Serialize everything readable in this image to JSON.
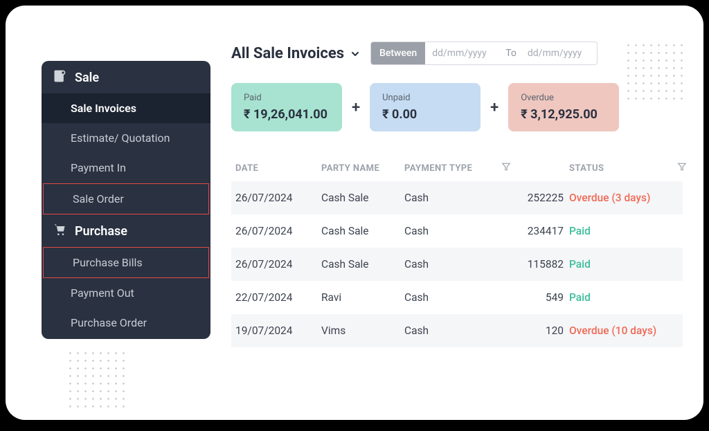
{
  "sidebar": {
    "groups": [
      {
        "id": "sale",
        "label": "Sale",
        "items": [
          {
            "id": "sale-invoices",
            "label": "Sale Invoices",
            "active": true,
            "boxed": false
          },
          {
            "id": "estimate-quotation",
            "label": "Estimate/ Quotation",
            "active": false,
            "boxed": false
          },
          {
            "id": "payment-in",
            "label": "Payment In",
            "active": false,
            "boxed": false
          },
          {
            "id": "sale-order",
            "label": "Sale Order",
            "active": false,
            "boxed": true
          }
        ]
      },
      {
        "id": "purchase",
        "label": "Purchase",
        "items": [
          {
            "id": "purchase-bills",
            "label": "Purchase Bills",
            "active": false,
            "boxed": true
          },
          {
            "id": "payment-out",
            "label": "Payment Out",
            "active": false,
            "boxed": false
          },
          {
            "id": "purchase-order",
            "label": "Purchase Order",
            "active": false,
            "boxed": false
          }
        ]
      }
    ]
  },
  "header": {
    "title": "All Sale Invoices",
    "between_label": "Between",
    "to_label": "To",
    "date_placeholder": "dd/mm/yyyy"
  },
  "summary": {
    "paid": {
      "label": "Paid",
      "value": "₹ 19,26,041.00"
    },
    "unpaid": {
      "label": "Unpaid",
      "value": "₹ 0.00"
    },
    "overdue": {
      "label": "Overdue",
      "value": "₹ 3,12,925.00"
    },
    "plus": "+"
  },
  "table": {
    "columns": {
      "date": "DATE",
      "party": "PARTY NAME",
      "payment_type": "PAYMENT TYPE",
      "amount": "",
      "status": "STATUS"
    },
    "rows": [
      {
        "date": "26/07/2024",
        "party": "Cash Sale",
        "payment_type": "Cash",
        "amount": "252225",
        "status_text": "Overdue (3 days)",
        "status_kind": "overdue"
      },
      {
        "date": "26/07/2024",
        "party": "Cash Sale",
        "payment_type": "Cash",
        "amount": "234417",
        "status_text": "Paid",
        "status_kind": "paid"
      },
      {
        "date": "26/07/2024",
        "party": "Cash Sale",
        "payment_type": "Cash",
        "amount": "115882",
        "status_text": "Paid",
        "status_kind": "paid"
      },
      {
        "date": "22/07/2024",
        "party": "Ravi",
        "payment_type": "Cash",
        "amount": "549",
        "status_text": "Paid",
        "status_kind": "paid"
      },
      {
        "date": "19/07/2024",
        "party": "Vims",
        "payment_type": "Cash",
        "amount": "120",
        "status_text": "Overdue (10 days)",
        "status_kind": "overdue"
      }
    ]
  }
}
